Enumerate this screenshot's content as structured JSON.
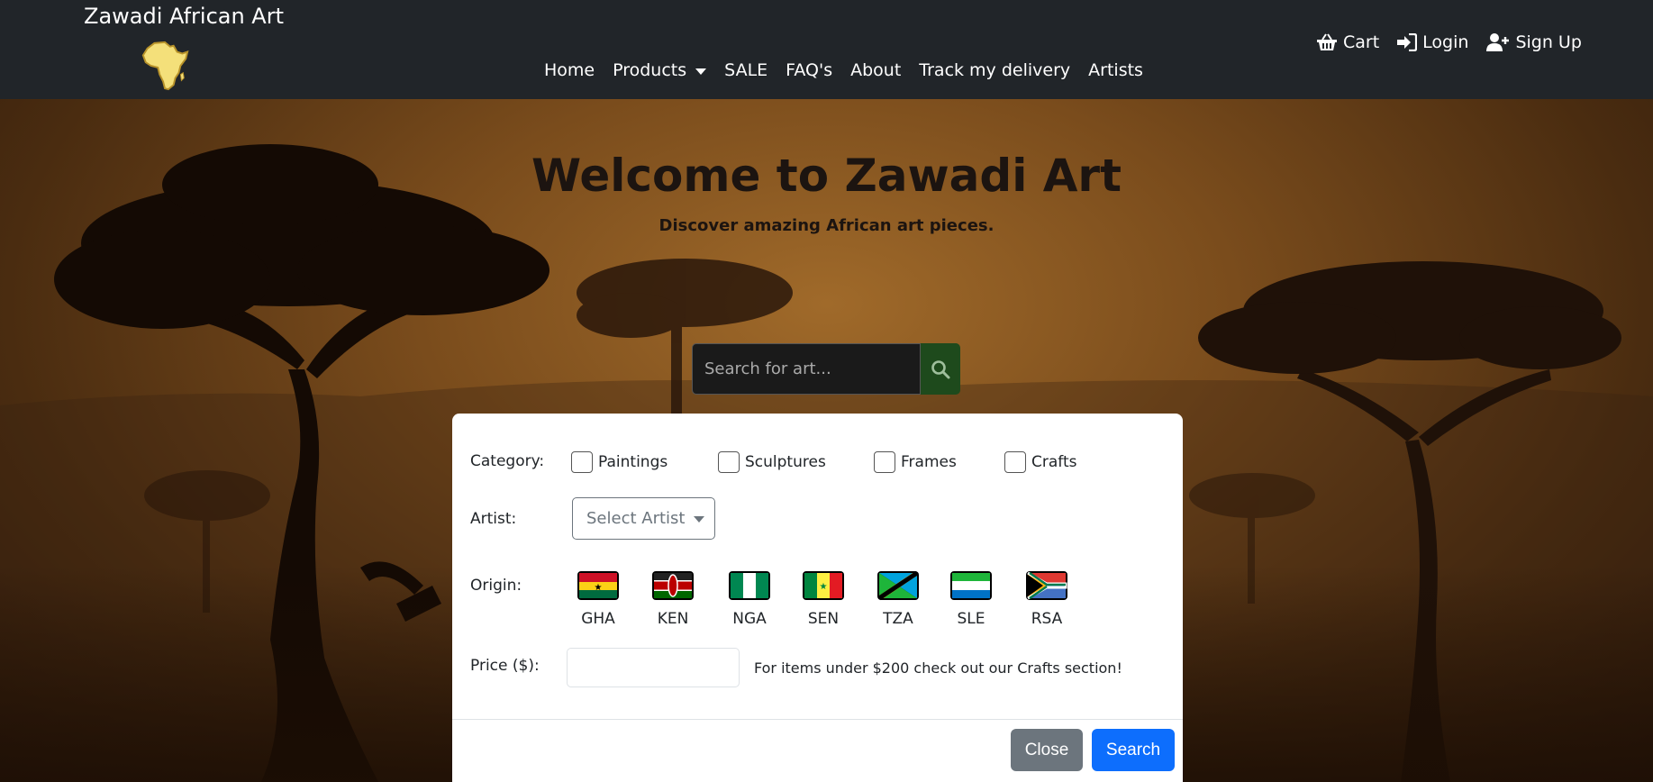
{
  "navbar": {
    "brand": "Zawadi African Art",
    "links": [
      {
        "label": "Home"
      },
      {
        "label": "Products",
        "dropdown": true
      },
      {
        "label": "SALE"
      },
      {
        "label": "FAQ's"
      },
      {
        "label": "About"
      },
      {
        "label": "Track my delivery"
      },
      {
        "label": "Artists"
      }
    ],
    "right": [
      {
        "label": "Cart",
        "icon": "basket-icon"
      },
      {
        "label": "Login",
        "icon": "login-icon"
      },
      {
        "label": "Sign Up",
        "icon": "user-plus-icon"
      }
    ]
  },
  "hero": {
    "title": "Welcome to Zawadi Art",
    "subtitle": "Discover amazing African art pieces.",
    "search_placeholder": "Search for art..."
  },
  "filters": {
    "category_label": "Category:",
    "categories": [
      "Paintings",
      "Sculptures",
      "Frames",
      "Crafts"
    ],
    "artist_label": "Artist:",
    "artist_select": "Select Artist",
    "origin_label": "Origin:",
    "origins": [
      "GHA",
      "KEN",
      "NGA",
      "SEN",
      "TZA",
      "SLE",
      "RSA"
    ],
    "price_label": "Price ($):",
    "price_value": "",
    "price_note": "For items under $200 check out our Crafts section!",
    "close_label": "Close",
    "search_label": "Search"
  },
  "colors": {
    "navbar_bg": "#212529",
    "primary": "#0d6efd",
    "secondary": "#6c757d",
    "search_btn": "#1e4a1c"
  }
}
